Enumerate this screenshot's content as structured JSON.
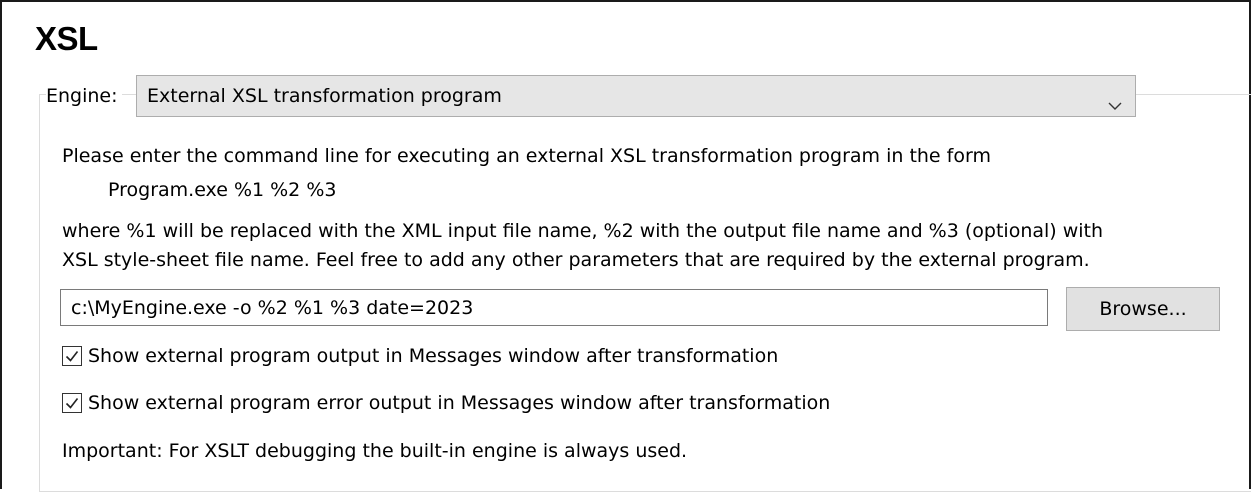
{
  "section": {
    "title": "XSL"
  },
  "engine": {
    "label": "Engine:",
    "selected": "External XSL transformation program",
    "icon": "chevron-down-icon"
  },
  "instructions": {
    "line1": "Please enter the command line for executing an external XSL transformation program in the form",
    "example": "Program.exe %1 %2 %3",
    "line2": "where %1 will be replaced with the XML input file name, %2 with the output file name and %3 (optional) with",
    "line3": "XSL style-sheet  file name. Feel free to add any other parameters that are required by the external program."
  },
  "command": {
    "value": "c:\\MyEngine.exe -o %2 %1 %3 date=2023"
  },
  "browse_button": {
    "label": "Browse..."
  },
  "checkboxes": [
    {
      "label": "Show external program output in Messages window after transformation",
      "checked": true
    },
    {
      "label": "Show external program error output in Messages window after transformation",
      "checked": true
    }
  ],
  "note": {
    "text": "Important: For XSLT debugging the built-in engine is always used."
  },
  "colors": {
    "select_background": "#e6e6e6",
    "button_background": "#e1e1e1",
    "border": "#adadad"
  }
}
